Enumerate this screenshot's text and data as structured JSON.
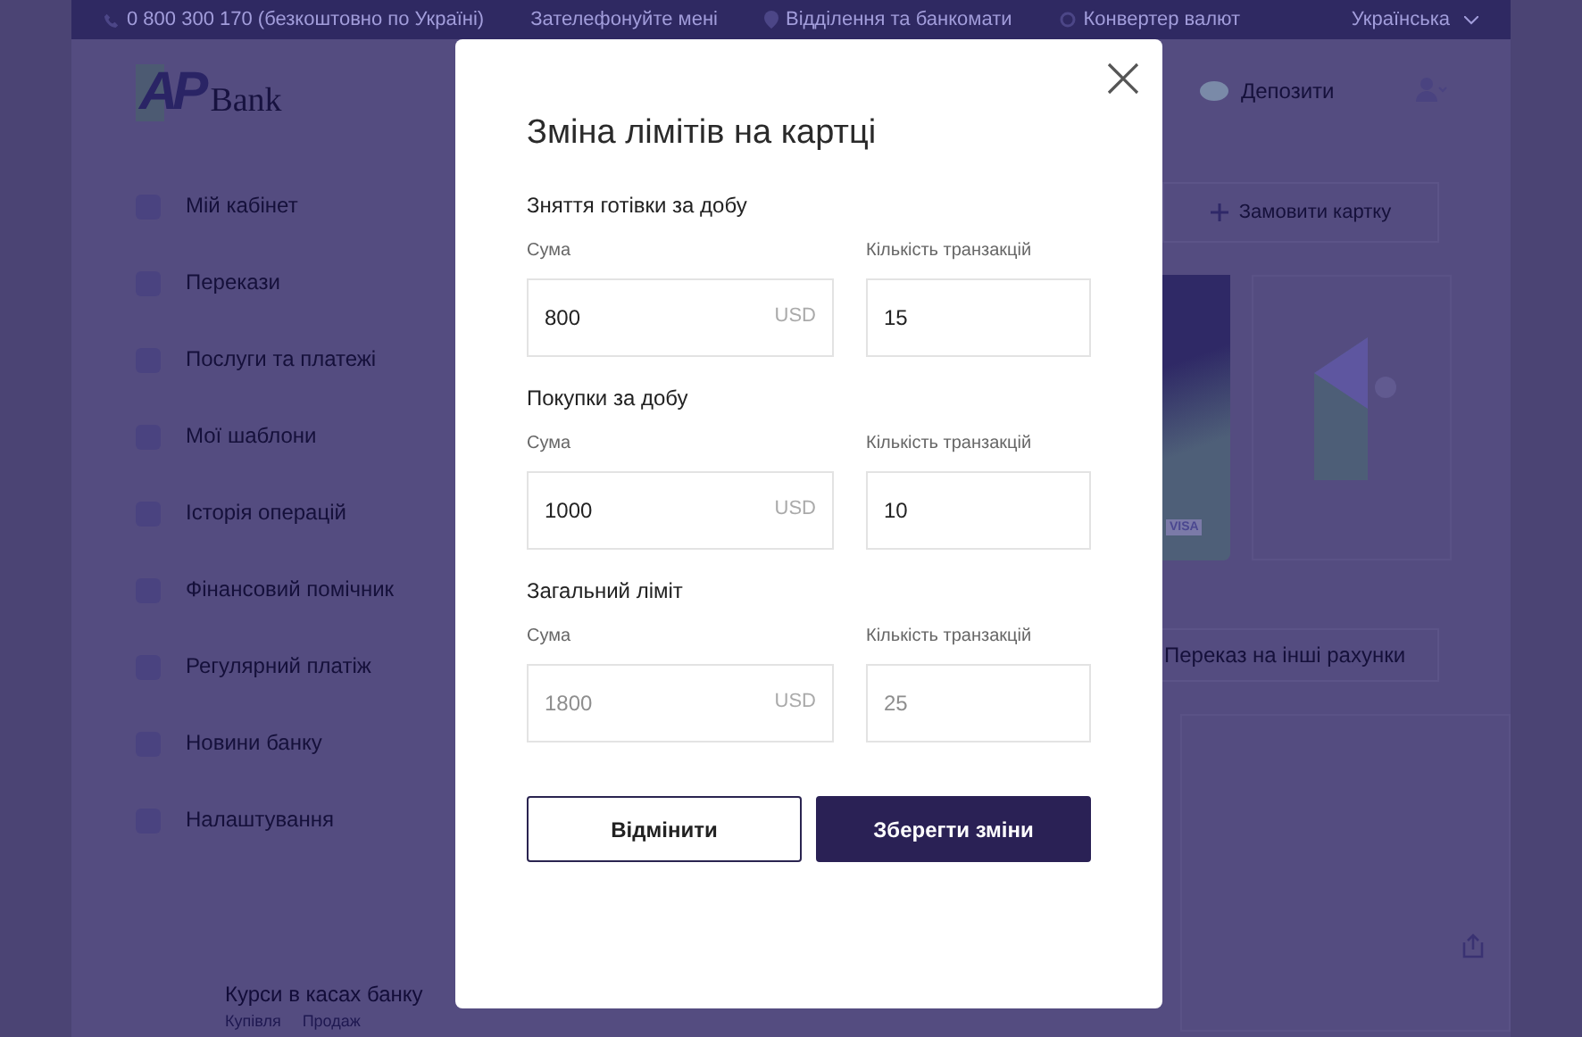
{
  "top_bar": {
    "phone": "0 800 300 170 (безкоштовно по Україні)",
    "callback": "Зателефонуйте мені",
    "branches": "Відділення та банкомати",
    "converter": "Конвертер валют",
    "language": "Українська"
  },
  "logo": {
    "mark": "AP",
    "name": "Bank"
  },
  "sidebar": {
    "items": [
      "Мій кабінет",
      "Перекази",
      "Послуги та платежі",
      "Мої шаблони",
      "Історія операцій",
      "Фінансовий помічник",
      "Регулярний платіж",
      "Новини банку",
      "Налаштування"
    ]
  },
  "rates": {
    "title": "Курси в касах банку",
    "columns": [
      "Купівля",
      "Продаж"
    ]
  },
  "header": {
    "deposits": "Депозити"
  },
  "order_card": "Замовити картку",
  "card_badge": "VISA",
  "transfer_button": "Переказ на інші рахунки",
  "modal": {
    "title": "Зміна лімітів на картці",
    "sections": [
      {
        "heading": "Зняття готівки за добу",
        "amount_label": "Сума",
        "amount": "800",
        "currency": "USD",
        "count_label": "Кількість транзакцій",
        "count": "15",
        "disabled": false
      },
      {
        "heading": "Покупки за добу",
        "amount_label": "Сума",
        "amount": "1000",
        "currency": "USD",
        "count_label": "Кількість транзакцій",
        "count": "10",
        "disabled": false
      },
      {
        "heading": "Загальний ліміт",
        "amount_label": "Сума",
        "amount": "1800",
        "currency": "USD",
        "count_label": "Кількість транзакцій",
        "count": "25",
        "disabled": true
      }
    ],
    "cancel": "Відмінити",
    "save": "Зберегти зміни"
  }
}
